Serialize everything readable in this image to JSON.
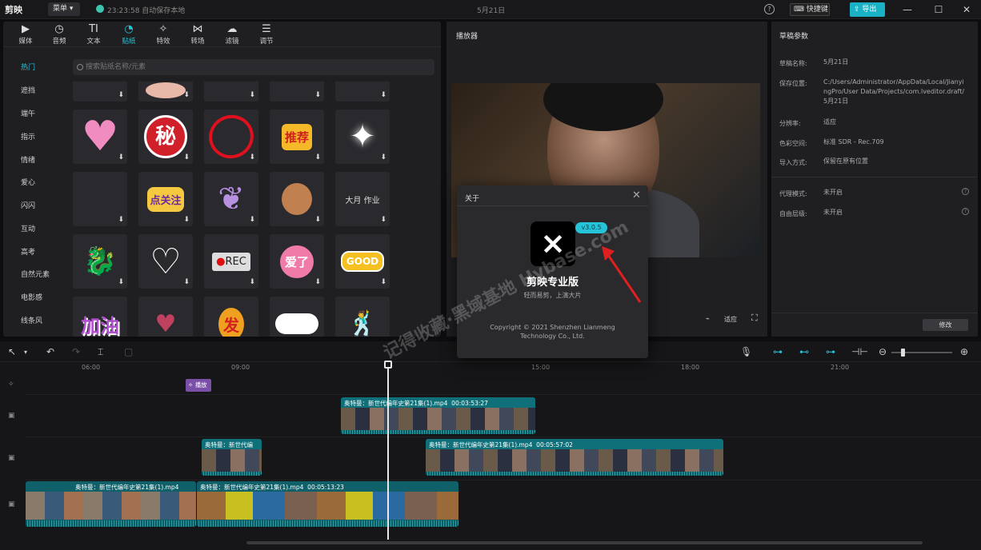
{
  "app": {
    "logo": "剪映",
    "menu_label": "菜单",
    "save_status": "23:23:58 自动保存本地",
    "project_title": "5月21日",
    "shortcut_label": "快捷键",
    "export_label": "导出"
  },
  "toolbar": [
    {
      "label": "媒体",
      "icon": "media-icon"
    },
    {
      "label": "音频",
      "icon": "audio-icon"
    },
    {
      "label": "文本",
      "icon": "text-icon"
    },
    {
      "label": "贴纸",
      "icon": "sticker-icon"
    },
    {
      "label": "特效",
      "icon": "effects-icon"
    },
    {
      "label": "转场",
      "icon": "transition-icon"
    },
    {
      "label": "滤镜",
      "icon": "filter-icon"
    },
    {
      "label": "调节",
      "icon": "adjust-icon"
    }
  ],
  "categories": [
    "热门",
    "遮挡",
    "端午",
    "指示",
    "情绪",
    "爱心",
    "闪闪",
    "互动",
    "高考",
    "自然元素",
    "电影感",
    "线条风"
  ],
  "search": {
    "placeholder": "搜索贴纸名称/元素"
  },
  "stickers": {
    "r1": [
      "秘",
      "推荐"
    ],
    "r2": [
      "点关注",
      "大月 作业"
    ],
    "r3": [
      "REC",
      "爱了",
      "GOOD"
    ],
    "r4": [
      "加油",
      "发"
    ]
  },
  "player": {
    "title": "播放器",
    "ratio": "适应"
  },
  "draft": {
    "title": "草稿参数",
    "rows": [
      {
        "label": "草稿名称:",
        "value": "5月21日"
      },
      {
        "label": "保存位置:",
        "value": "C:/Users/Administrator/AppData/Local/JianyingPro/User Data/Projects/com.lveditor.draft/5月21日"
      },
      {
        "label": "分辨率:",
        "value": "适应"
      },
      {
        "label": "色彩空间:",
        "value": "标准 SDR - Rec.709"
      },
      {
        "label": "导入方式:",
        "value": "保留在原有位置"
      },
      {
        "label": "代理模式:",
        "value": "未开启"
      },
      {
        "label": "自由层级:",
        "value": "未开启"
      }
    ],
    "modify_label": "修改"
  },
  "about": {
    "title": "关于",
    "version": "v3.0.5",
    "app_name": "剪映专业版",
    "slogan": "轻而易剪，上演大片",
    "copyright_1": "Copyright © 2021 Shenzhen Lianmeng",
    "copyright_2": "Technology Co., Ltd."
  },
  "timeline": {
    "ticks": [
      "06:00",
      "09:00",
      "15:00",
      "18:00",
      "21:00"
    ],
    "effect_label": "播放",
    "clips": {
      "c1": "奥特曼：新世代编年史第21集(1).mp4",
      "c1_time": "00:03:53:27",
      "c2": "奥特曼：新世代编",
      "c3": "奥特曼：新世代编年史第21集(1).mp4",
      "c3_time": "00:05:57:02",
      "c4": "奥特曼：新世代编年史第21集(1).mp4",
      "c5": "奥特曼：新世代编年史第21集(1).mp4",
      "c5_time": "00:05:13:23"
    }
  },
  "watermark": "记得收藏·黑域基地 Hybase.com"
}
